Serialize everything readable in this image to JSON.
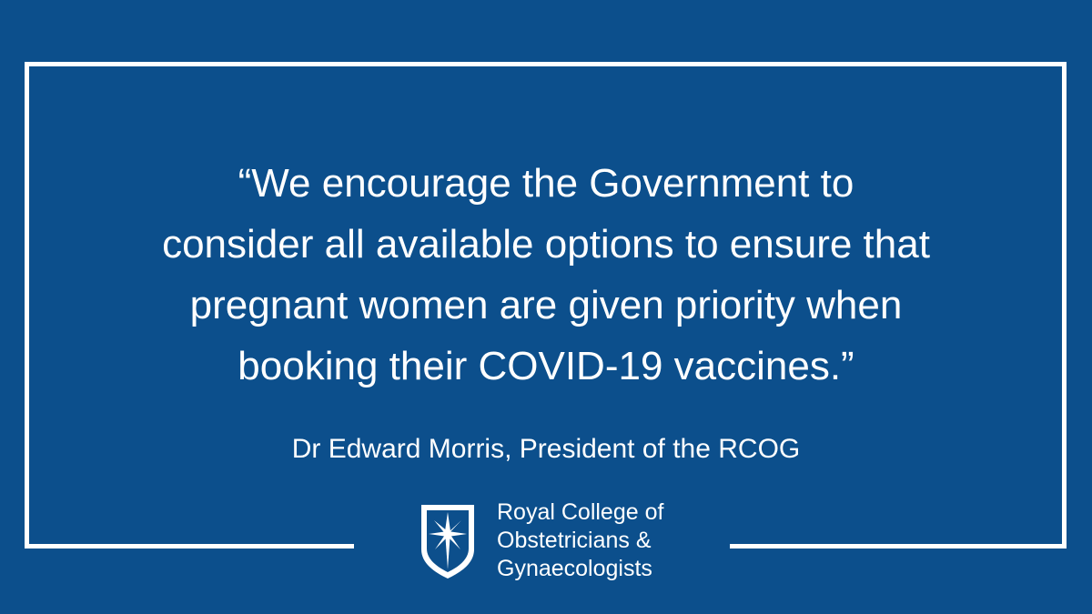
{
  "quote": {
    "lines": [
      "“We encourage the Government to",
      "consider all available options to ensure that",
      "pregnant women are given priority when",
      "booking their COVID-19 vaccines.”"
    ]
  },
  "attribution": "Dr Edward Morris, President of the RCOG",
  "logo": {
    "icon": "star-shield-icon",
    "lines": [
      "Royal College of",
      "Obstetricians &",
      "Gynaecologists"
    ]
  },
  "colors": {
    "background": "#0c4f8c",
    "foreground": "#ffffff"
  }
}
